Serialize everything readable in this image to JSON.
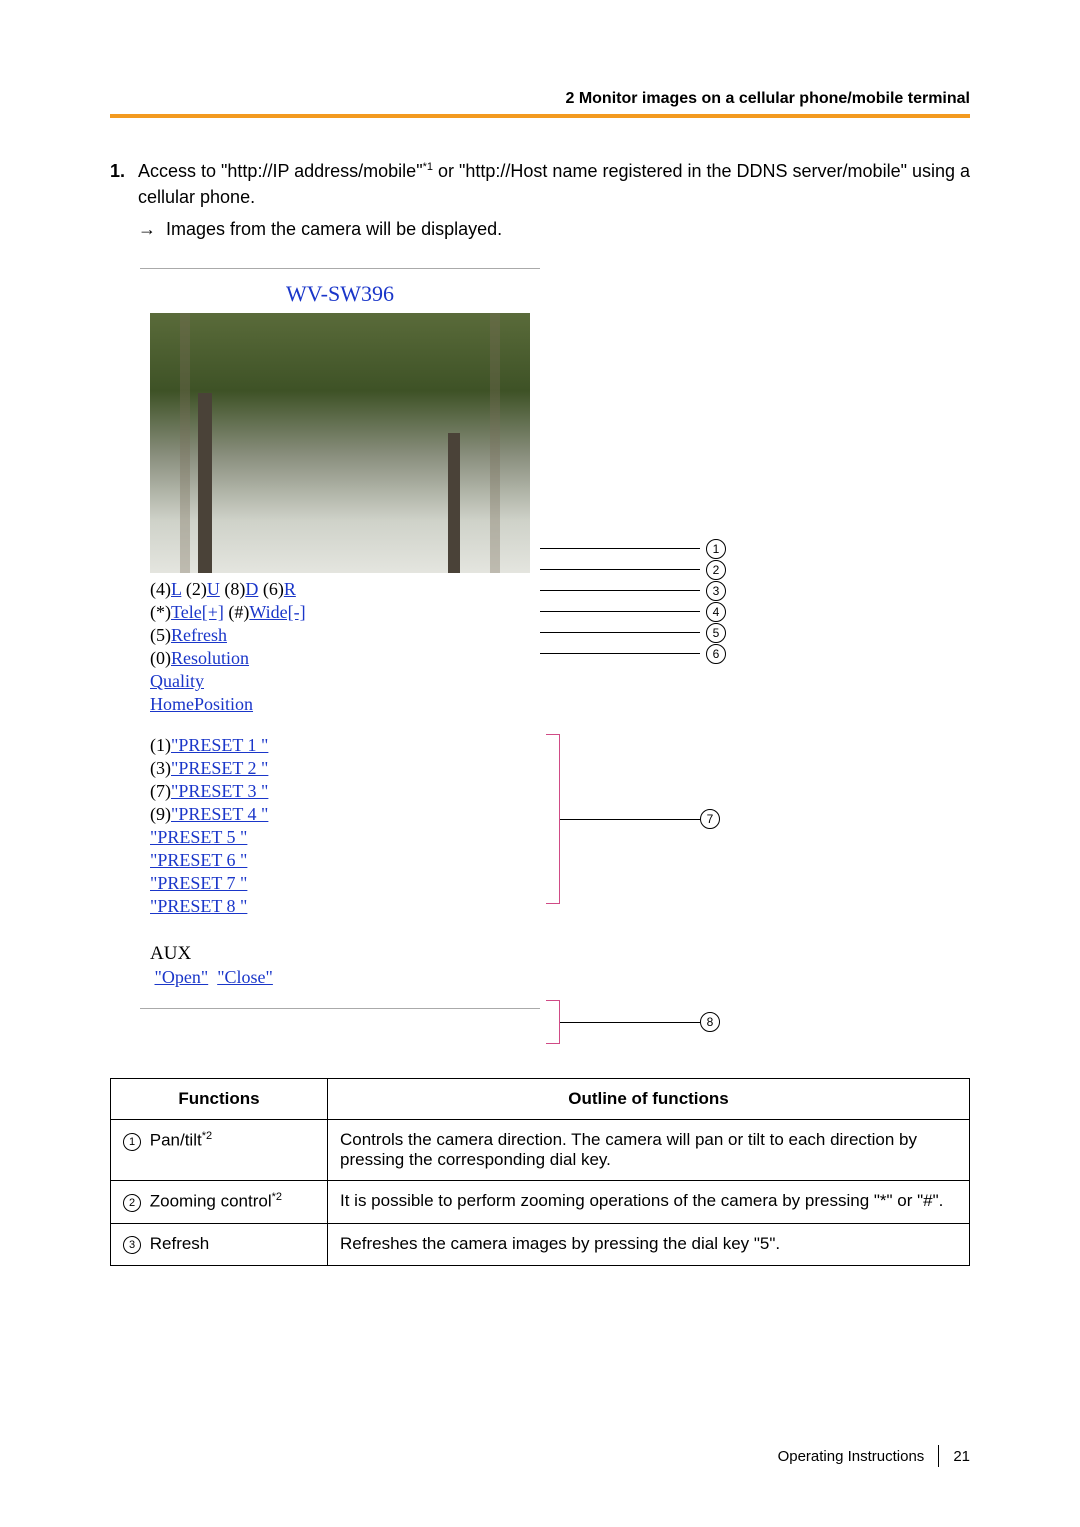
{
  "header": {
    "section_title": "2  Monitor images on a cellular phone/mobile terminal"
  },
  "step": {
    "number": "1.",
    "text_a": "Access to \"http://IP address/mobile\"",
    "note1": "*1",
    "text_b": " or \"http://Host name registered in the DDNS server/mobile\" using a cellular phone.",
    "arrow": "→",
    "result": "Images from the camera will be displayed."
  },
  "phone": {
    "title": "WV-SW396",
    "pan": {
      "p4": "(4)",
      "L": "L",
      "p2": " (2)",
      "U": "U",
      "p8": " (8)",
      "D": "D",
      "p6": " (6)",
      "R": "R"
    },
    "zoom": {
      "star": "(*)",
      "tele": "Tele[+]",
      "hash": " (#)",
      "wide": "Wide[-]"
    },
    "refresh": {
      "key": "(5)",
      "label": "Refresh"
    },
    "resolution": {
      "key": "(0)",
      "label": "Resolution"
    },
    "quality": "Quality",
    "home": "HomePosition",
    "presets": [
      {
        "key": "(1)",
        "label": "\"PRESET 1 \""
      },
      {
        "key": "(3)",
        "label": "\"PRESET 2 \""
      },
      {
        "key": "(7)",
        "label": "\"PRESET 3 \""
      },
      {
        "key": "(9)",
        "label": "\"PRESET 4 \""
      },
      {
        "key": "",
        "label": "\"PRESET 5 \""
      },
      {
        "key": "",
        "label": "\"PRESET 6 \""
      },
      {
        "key": "",
        "label": "\"PRESET 7 \""
      },
      {
        "key": "",
        "label": "\"PRESET 8 \""
      }
    ],
    "aux": {
      "title": "AUX",
      "open": "\"Open\"",
      "close": "\"Close\""
    }
  },
  "callout_nums": [
    "1",
    "2",
    "3",
    "4",
    "5",
    "6",
    "7",
    "8"
  ],
  "table": {
    "head": {
      "func": "Functions",
      "outline": "Outline of functions"
    },
    "rows": [
      {
        "n": "1",
        "name": "Pan/tilt",
        "note": "*2",
        "desc": "Controls the camera direction. The camera will pan or tilt to each direction by pressing the corresponding dial key."
      },
      {
        "n": "2",
        "name": "Zooming control",
        "note": "*2",
        "desc": "It is possible to perform zooming operations of the camera by pressing \"*\" or \"#\"."
      },
      {
        "n": "3",
        "name": "Refresh",
        "note": "",
        "desc": "Refreshes the camera images by pressing the dial key \"5\"."
      }
    ]
  },
  "footer": {
    "doc": "Operating Instructions",
    "page": "21"
  }
}
